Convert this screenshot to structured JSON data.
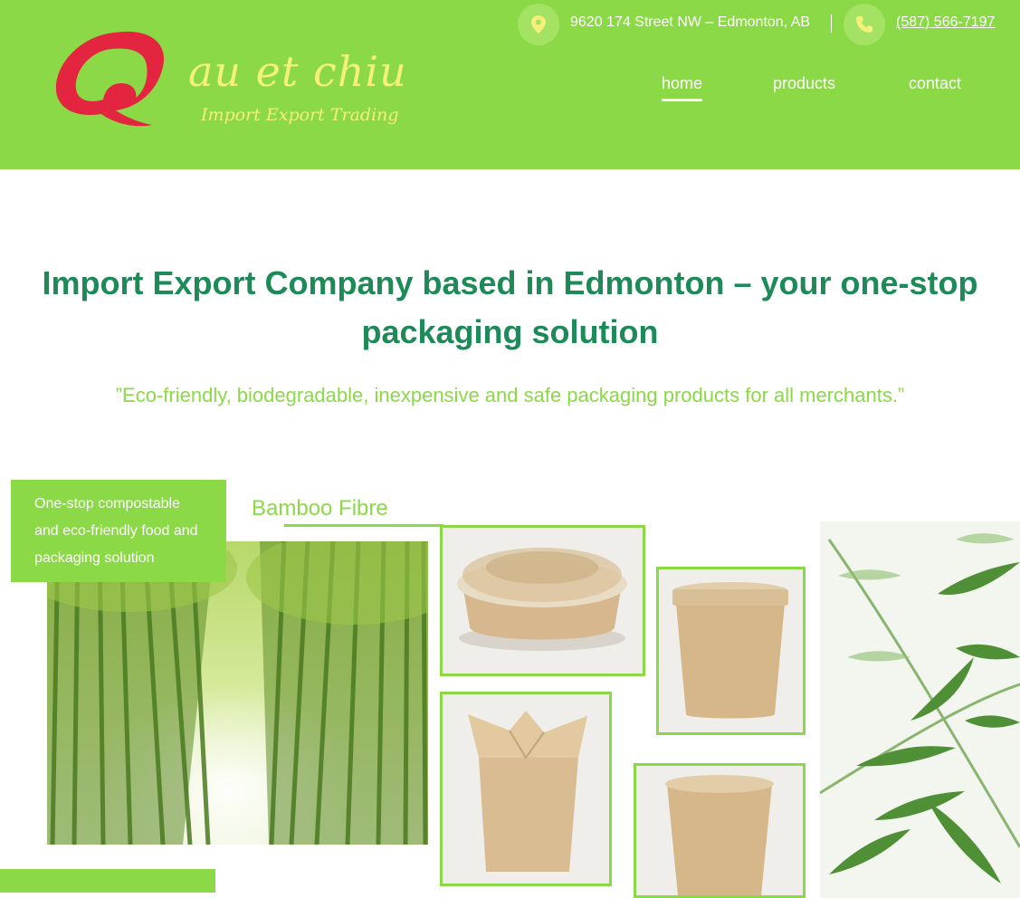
{
  "brand": {
    "name": "au et chiu",
    "tagline": "Import Export Trading",
    "logo_icon": "speech-bubble-logo-icon",
    "colors": {
      "header_green": "#8bd947",
      "logo_red": "#e3253f",
      "logo_yellow": "#f4f07a",
      "headline_green": "#1f8a59"
    }
  },
  "topbar": {
    "address": "9620 174 Street NW – Edmonton, AB",
    "address_icon": "map-pin-icon",
    "phone": "(587) 566-7197",
    "phone_icon": "phone-icon"
  },
  "nav": {
    "items": [
      {
        "label": "home",
        "active": true
      },
      {
        "label": "products",
        "active": false
      },
      {
        "label": "contact",
        "active": false
      }
    ]
  },
  "hero": {
    "headline_line1": "Import Export Company based in Edmonton – your one-stop",
    "headline_line2": "packaging solution",
    "subheadline": "”Eco-friendly, biodegradable, inexpensive and safe packaging products for all merchants.”"
  },
  "feature": {
    "promo_line1": "One-stop compostable",
    "promo_line2": "and eco-friendly food and",
    "promo_line3": "packaging solution",
    "section_title": "Bamboo Fibre"
  }
}
